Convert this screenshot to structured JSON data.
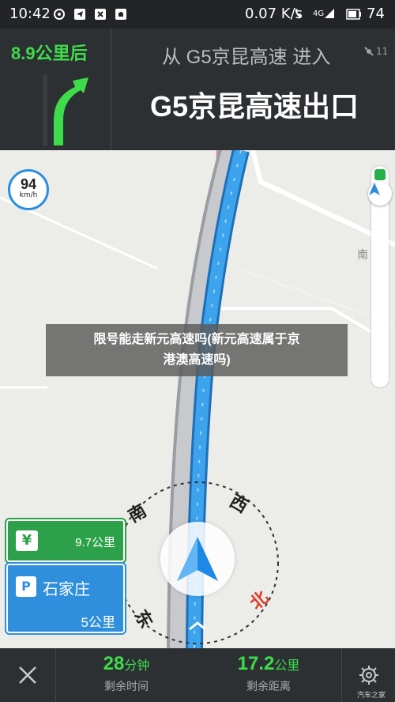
{
  "status_bar": {
    "time": "10:42",
    "net_speed": "0.07 K/s",
    "signal": "4G",
    "battery": "74"
  },
  "guidance": {
    "distance_to_turn": "8.9公里后",
    "from_road": "从 G5京昆高速 进入",
    "gps_count": "11",
    "next_road": "G5京昆高速出口"
  },
  "map": {
    "speed_value": "94",
    "speed_unit": "km/h",
    "edge_label": "南",
    "caption_line1": "限号能走新元高速吗(新元高速属于京",
    "caption_line2": "港澳高速吗)",
    "compass": {
      "north": "北",
      "south": "南",
      "east": "东",
      "west": "西"
    }
  },
  "signs": {
    "toll_symbol": "¥",
    "toll_distance": "9.7公里",
    "parking_symbol": "P",
    "city": "石家庄",
    "city_distance": "5公里"
  },
  "footer": {
    "time_value": "28",
    "time_unit": "分钟",
    "time_label": "剩余时间",
    "distance_value": "17.2",
    "distance_unit": "公里",
    "distance_label": "剩余距离"
  },
  "watermark": "汽车之家",
  "colors": {
    "accent_green": "#3ddc4a",
    "route_blue": "#2f8fdc",
    "panel": "#2d3033"
  }
}
